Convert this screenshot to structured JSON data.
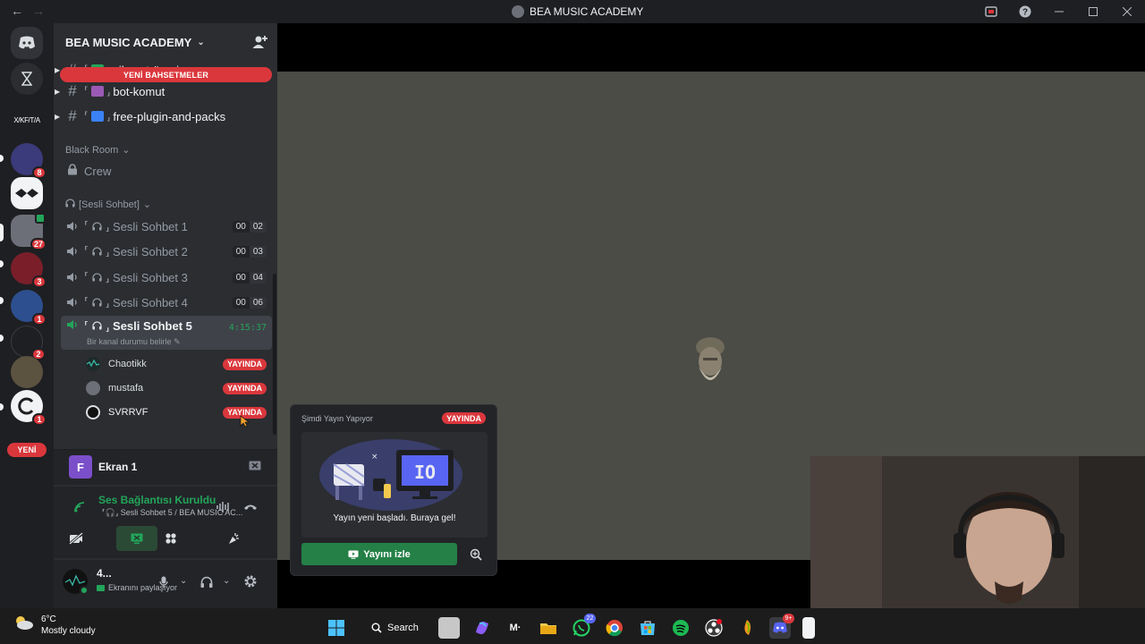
{
  "window": {
    "title": "BEA MUSIC ACADEMY"
  },
  "server": {
    "name": "BEA MUSIC ACADEMY"
  },
  "rail": {
    "badges": {
      "s1": "8",
      "s2": "27",
      "s3": "3",
      "s4": "1",
      "s5": "2",
      "s6": "1"
    },
    "ascii_server_label": "X/KF/T/A",
    "new_label": "YENİ"
  },
  "mentions_pill": "YENİ BAHSETMELER",
  "text_channels": [
    {
      "name": "şikayet-öneri"
    },
    {
      "name": "bot-komut"
    },
    {
      "name": "free-plugin-and-packs"
    }
  ],
  "categories": {
    "black_room": "Black Room",
    "voice": "[Sesli Sohbet]"
  },
  "crew_channel": "Crew",
  "bracket_open": "⸢",
  "bracket_close": "⸥",
  "voice_channels": [
    {
      "name": "Sesli Sohbet 1",
      "count_a": "00",
      "count_b": "02"
    },
    {
      "name": "Sesli Sohbet 2",
      "count_a": "00",
      "count_b": "03"
    },
    {
      "name": "Sesli Sohbet 3",
      "count_a": "00",
      "count_b": "04"
    },
    {
      "name": "Sesli Sohbet 4",
      "count_a": "00",
      "count_b": "06"
    },
    {
      "name": "Sesli Sohbet 5",
      "timer": "4:15:37",
      "status": "Bir kanal durumu belirle"
    }
  ],
  "voice_users": [
    {
      "name": "Chaotikk",
      "badge": "YAYINDA"
    },
    {
      "name": "mustafa",
      "badge": "YAYINDA"
    },
    {
      "name": "SVRRVF",
      "badge": "YAYINDA"
    }
  ],
  "stream_panel": {
    "initial": "F",
    "label": "Ekran 1"
  },
  "connection": {
    "status": "Ses Bağlantısı Kuruldu",
    "detail": "⸢🎧⸥ Sesli Sohbet 5 / BEA MUSIC AC..."
  },
  "user_panel": {
    "name": "4...",
    "status": "Ekranını paylaşıyor"
  },
  "popup": {
    "header": "Şimdi Yayın Yapıyor",
    "live": "YAYINDA",
    "message": "Yayın yeni başladı. Buraya gel!",
    "watch_button": "Yayını izle",
    "art_screen_text": "IO"
  },
  "taskbar": {
    "temp": "6°C",
    "weather": "Mostly cloudy",
    "search": "Search",
    "whatsapp_badge": "22",
    "discord_badge": "9+"
  },
  "colors": {
    "accent_red": "#da373c",
    "green": "#23a55a",
    "blurple": "#5865f2"
  }
}
